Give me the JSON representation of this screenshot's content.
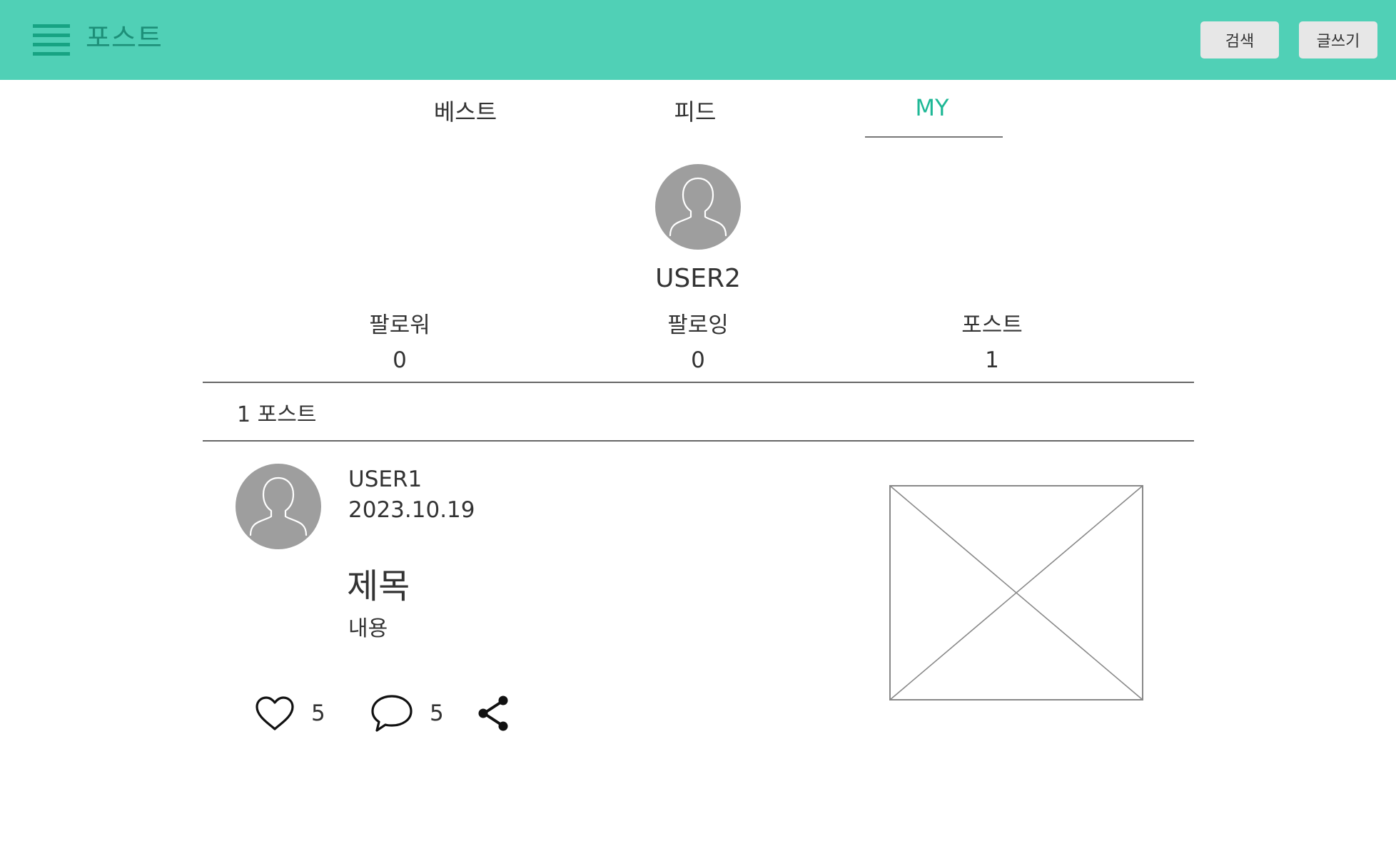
{
  "header": {
    "title": "포스트",
    "menu_icon": "hamburger-menu-icon",
    "search_label": "검색",
    "write_label": "글쓰기",
    "background_color": "#50d0b6"
  },
  "tabs": [
    {
      "label": "베스트",
      "active": false
    },
    {
      "label": "피드",
      "active": false
    },
    {
      "label": "MY",
      "active": true
    }
  ],
  "profile": {
    "name": "USER2",
    "avatar_icon": "user-silhouette-icon",
    "stats": {
      "followers": {
        "label": "팔로워",
        "value": "0"
      },
      "following": {
        "label": "팔로잉",
        "value": "0"
      },
      "posts": {
        "label": "포스트",
        "value": "1"
      }
    }
  },
  "posts_section": {
    "count_label": "1 포스트"
  },
  "post": {
    "author": "USER1",
    "date": "2023.10.19",
    "title": "제목",
    "content": "내용",
    "image_icon": "image-placeholder-icon",
    "likes": "5",
    "comments": "5",
    "like_icon": "heart-icon",
    "comment_icon": "speech-bubble-icon",
    "share_icon": "share-icon"
  },
  "colors": {
    "accent": "#1fb896",
    "avatar_gray": "#9e9e9e"
  }
}
